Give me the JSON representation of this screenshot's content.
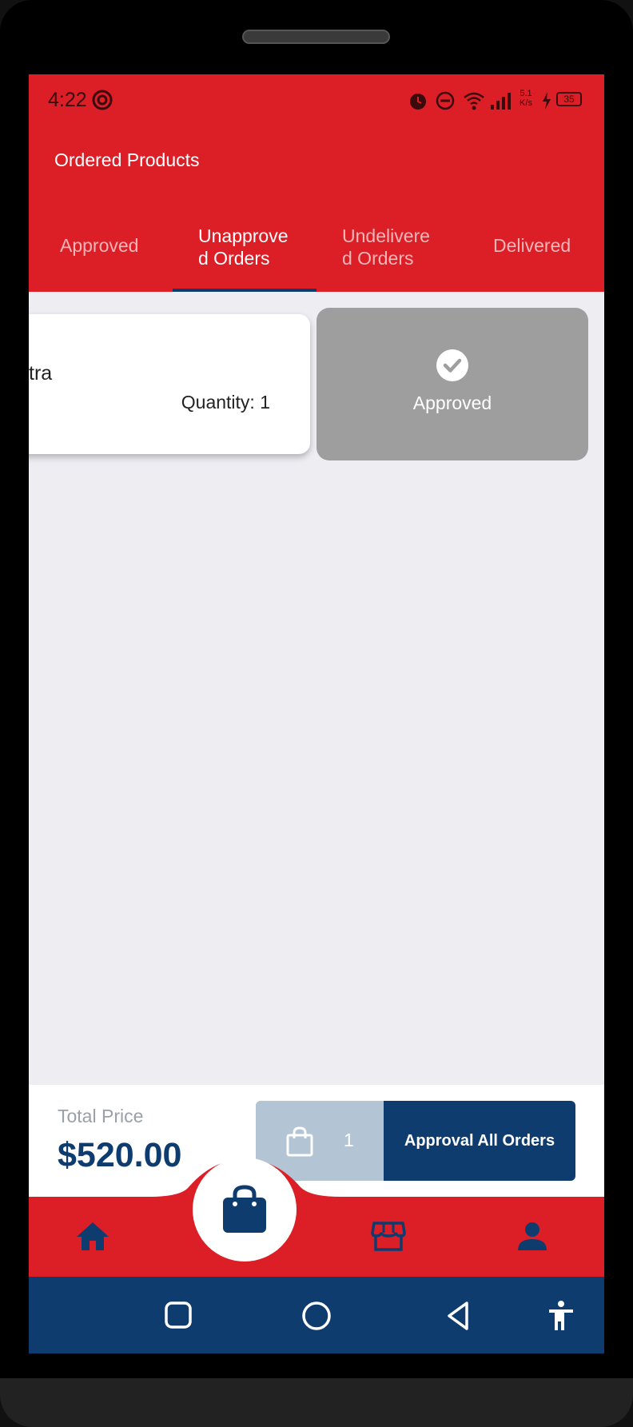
{
  "status_bar": {
    "time": "4:22",
    "network_speed_top": "5.1",
    "network_speed_bottom": "K/s",
    "battery": "35"
  },
  "app_bar": {
    "title": "Ordered Products"
  },
  "tabs": [
    {
      "label": "Approved",
      "active": false
    },
    {
      "label": "Unapprove\nd Orders",
      "active": true
    },
    {
      "label": "Undelivere\nd Orders",
      "active": false
    },
    {
      "label": "Delivered",
      "active": false
    }
  ],
  "order_card": {
    "name_partial": "tra",
    "quantity": "Quantity: 1"
  },
  "swipe_action": {
    "label": "Approved",
    "icon": "check-circle-icon"
  },
  "summary": {
    "total_label": "Total Price",
    "total_value": "$520.00",
    "cart_count": "1",
    "approve_all_label": "Approval All Orders"
  },
  "bottom_nav": [
    "home-icon",
    "shopping-bag-icon",
    "store-icon",
    "person-icon"
  ],
  "system_nav": [
    "recents-icon",
    "home-circle-icon",
    "back-icon",
    "accessibility-icon"
  ],
  "colors": {
    "primary_red": "#dc1e26",
    "navy": "#0f3c6e",
    "approved_grey": "#9e9e9e",
    "background": "#eeedf2"
  }
}
